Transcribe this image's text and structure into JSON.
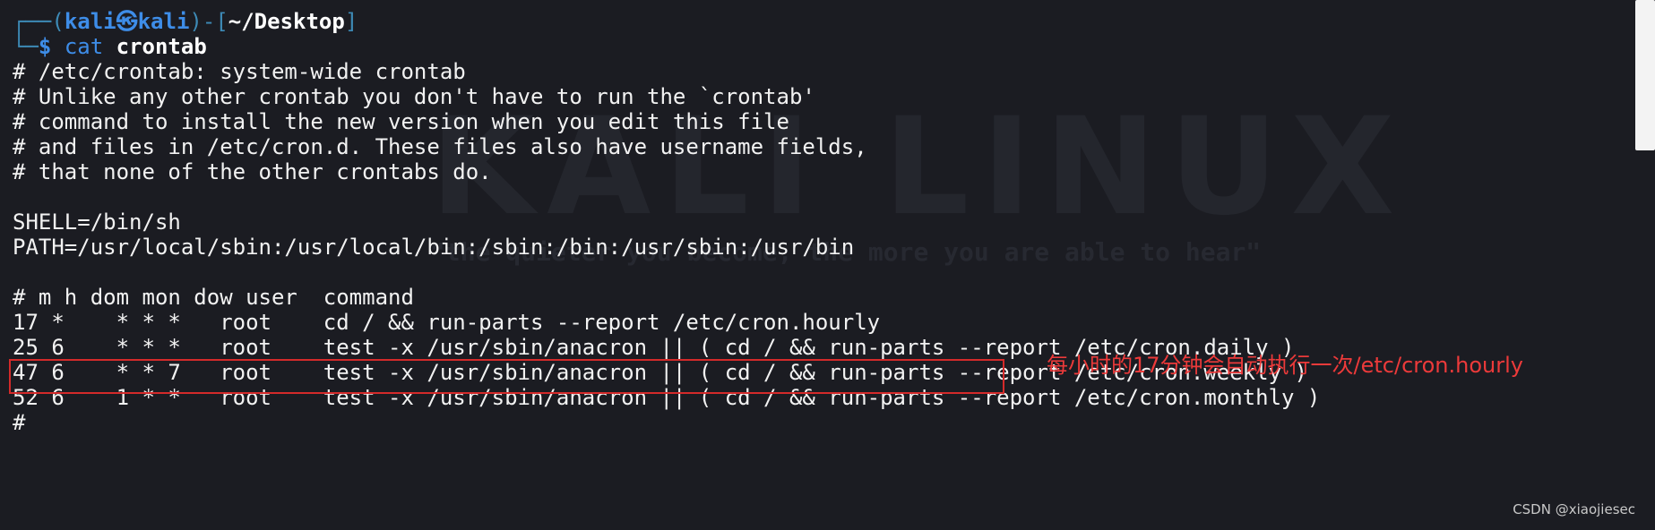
{
  "wallpaper": {
    "logo": "KALI LINUX",
    "tagline": "\"the quieter you become, the more you are able to hear\""
  },
  "prompt": {
    "frame_top": "┌──",
    "frame_bottom": "└─",
    "open_paren": "(",
    "user": "kali",
    "at_symbol": "㉿",
    "host": "kali",
    "close_paren": ")",
    "dash": "-",
    "open_bracket": "[",
    "cwd": "~/Desktop",
    "close_bracket": "]",
    "dollar": "$",
    "command": "cat",
    "argument": "crontab"
  },
  "output_lines": [
    "# /etc/crontab: system-wide crontab",
    "# Unlike any other crontab you don't have to run the `crontab'",
    "# command to install the new version when you edit this file",
    "# and files in /etc/cron.d. These files also have username fields,",
    "# that none of the other crontabs do.",
    "",
    "SHELL=/bin/sh",
    "PATH=/usr/local/sbin:/usr/local/bin:/sbin:/bin:/usr/sbin:/usr/bin",
    "",
    "# m h dom mon dow user  command",
    "17 *    * * *   root    cd / && run-parts --report /etc/cron.hourly",
    "25 6    * * *   root    test -x /usr/sbin/anacron || ( cd / && run-parts --report /etc/cron.daily )",
    "47 6    * * 7   root    test -x /usr/sbin/anacron || ( cd / && run-parts --report /etc/cron.weekly )",
    "52 6    1 * *   root    test -x /usr/sbin/anacron || ( cd / && run-parts --report /etc/cron.monthly )",
    "#"
  ],
  "annotation": {
    "text": "每小时的17分钟会自动执行一次/etc/cron.hourly",
    "color": "#ec3a3a"
  },
  "watermark": "CSDN @xiaojiesec",
  "colors": {
    "background": "#1b1c22",
    "text": "#f2f2f2",
    "prompt_blue": "#3e8de8",
    "highlight_red": "#d42a2a"
  }
}
